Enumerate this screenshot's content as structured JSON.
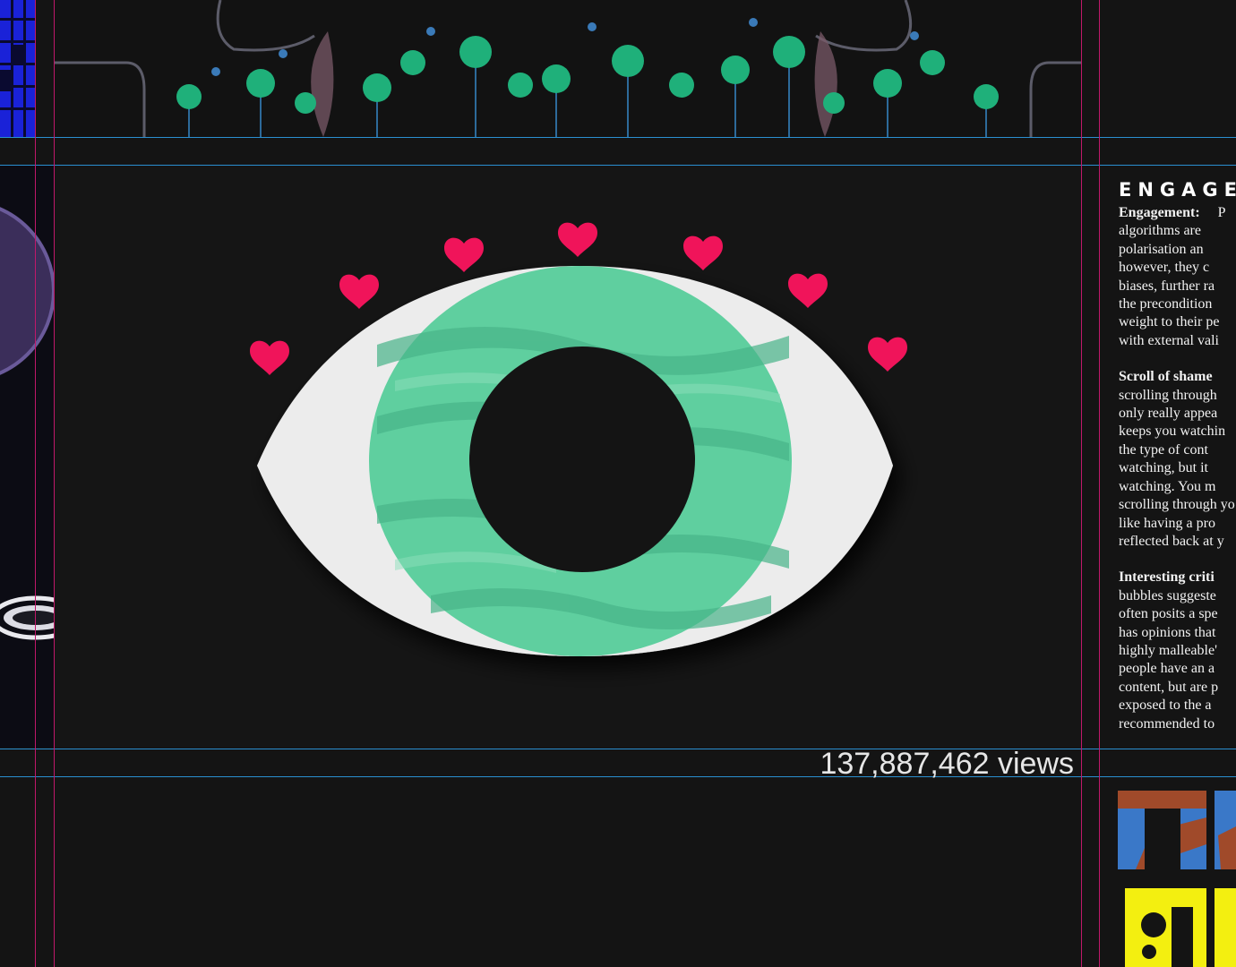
{
  "views_label": "137,887,462 views",
  "eye": {
    "hearts": 7,
    "colors": {
      "heart": "#f0145a",
      "iris": "#5fcf9f",
      "sclera": "#ececec",
      "pupil": "#141414"
    }
  },
  "article": {
    "title": "ENGAGEI",
    "paragraphs": [
      {
        "heading": "Engagement:",
        "lines": [
          "P",
          "algorithms are",
          "polarisation an",
          "however, they c",
          "biases, further ra",
          "the precondition",
          "weight to their pe",
          "with external vali"
        ]
      },
      {
        "heading": "Scroll of shame",
        "lines": [
          "scrolling through",
          "only really appea",
          "keeps you watchin",
          "the type of cont",
          "watching, but it",
          "watching. You m",
          "scrolling through yo",
          "like having a pro",
          "reflected back at y"
        ]
      },
      {
        "heading": "Interesting criti",
        "lines": [
          "bubbles suggeste",
          "often posits a spe",
          "has opinions that",
          "highly malleable'",
          "people have an a",
          "content, but are p",
          "exposed to the a",
          "recommended to"
        ]
      }
    ]
  },
  "colors": {
    "background": "#141414",
    "guide_blue": "#2a8fd0",
    "guide_magenta": "#c0186a"
  }
}
